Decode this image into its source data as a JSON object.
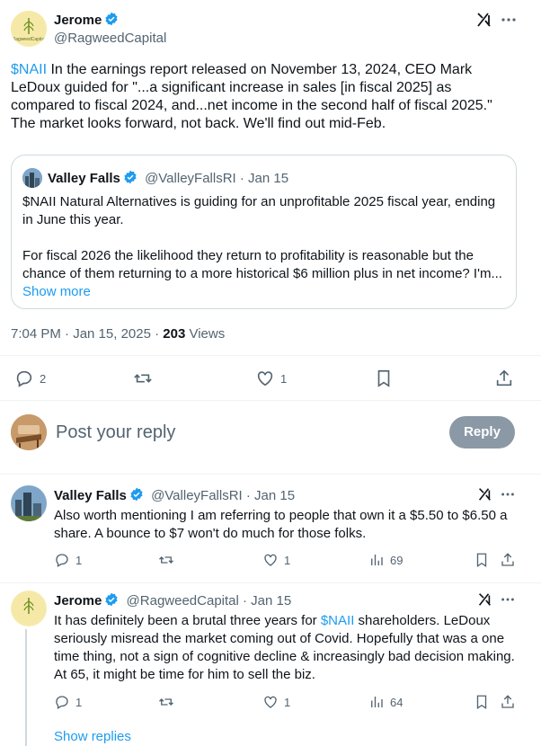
{
  "main_tweet": {
    "author_name": "Jerome",
    "author_handle": "@RagweedCapital",
    "avatar_text": "RagweedCapital",
    "text_link": "$NAII",
    "text_line1_rest": " In the earnings report released on November 13, 2024, CEO Mark",
    "text_line2": "LeDoux guided for \"...a significant increase in sales [in fiscal 2025] as",
    "text_line3": "compared to fiscal 2024, and...net income in the second half of fiscal 2025.\"",
    "text_line4": "The market looks forward, not back. We'll find out mid-Feb.",
    "time": "7:04 PM · Jan 15, 2025 · ",
    "views_count": "203",
    "views_label": " Views",
    "replies": "2",
    "likes": "1"
  },
  "quoted_tweet": {
    "author_name": "Valley Falls",
    "meta": "@ValleyFallsRI · Jan 15",
    "line1": "$NAII Natural Alternatives is guiding for an unprofitable 2025 fiscal year, ending",
    "line2": "in June this year.",
    "line3": "For fiscal 2026 the likelihood they return to profitability is reasonable but the",
    "line4": "chance of them returning to a more historical $6 million plus in net income? I'm...",
    "show_more": "Show more"
  },
  "composer": {
    "placeholder": "Post your reply",
    "button": "Reply"
  },
  "replies": [
    {
      "author_name": "Valley Falls",
      "meta": "@ValleyFallsRI · Jan 15",
      "line1": "Also worth mentioning I am referring to people that own it a $5.50 to $6.50 a",
      "line2": "share. A bounce to $7 won't do much for those folks.",
      "replies": "1",
      "likes": "1",
      "views": "69"
    },
    {
      "author_name": "Jerome",
      "meta": "@RagweedCapital · Jan 15",
      "line1_pre": "It has definitely been a brutal three years for ",
      "line1_link": "$NAII",
      "line1_post": " shareholders. LeDoux",
      "line2": "seriously misread the market coming out of Covid. Hopefully that was a one",
      "line3": "time thing, not a sign of cognitive decline & increasingly bad decision making.",
      "line4": "At 65, it might be time for him to sell the biz.",
      "replies": "1",
      "likes": "1",
      "views": "64"
    }
  ],
  "show_replies": "Show replies",
  "colors": {
    "accent": "#1d9bf0",
    "muted": "#536471",
    "verified": "#1d9bf0",
    "reply_button": "#8b98a5"
  }
}
